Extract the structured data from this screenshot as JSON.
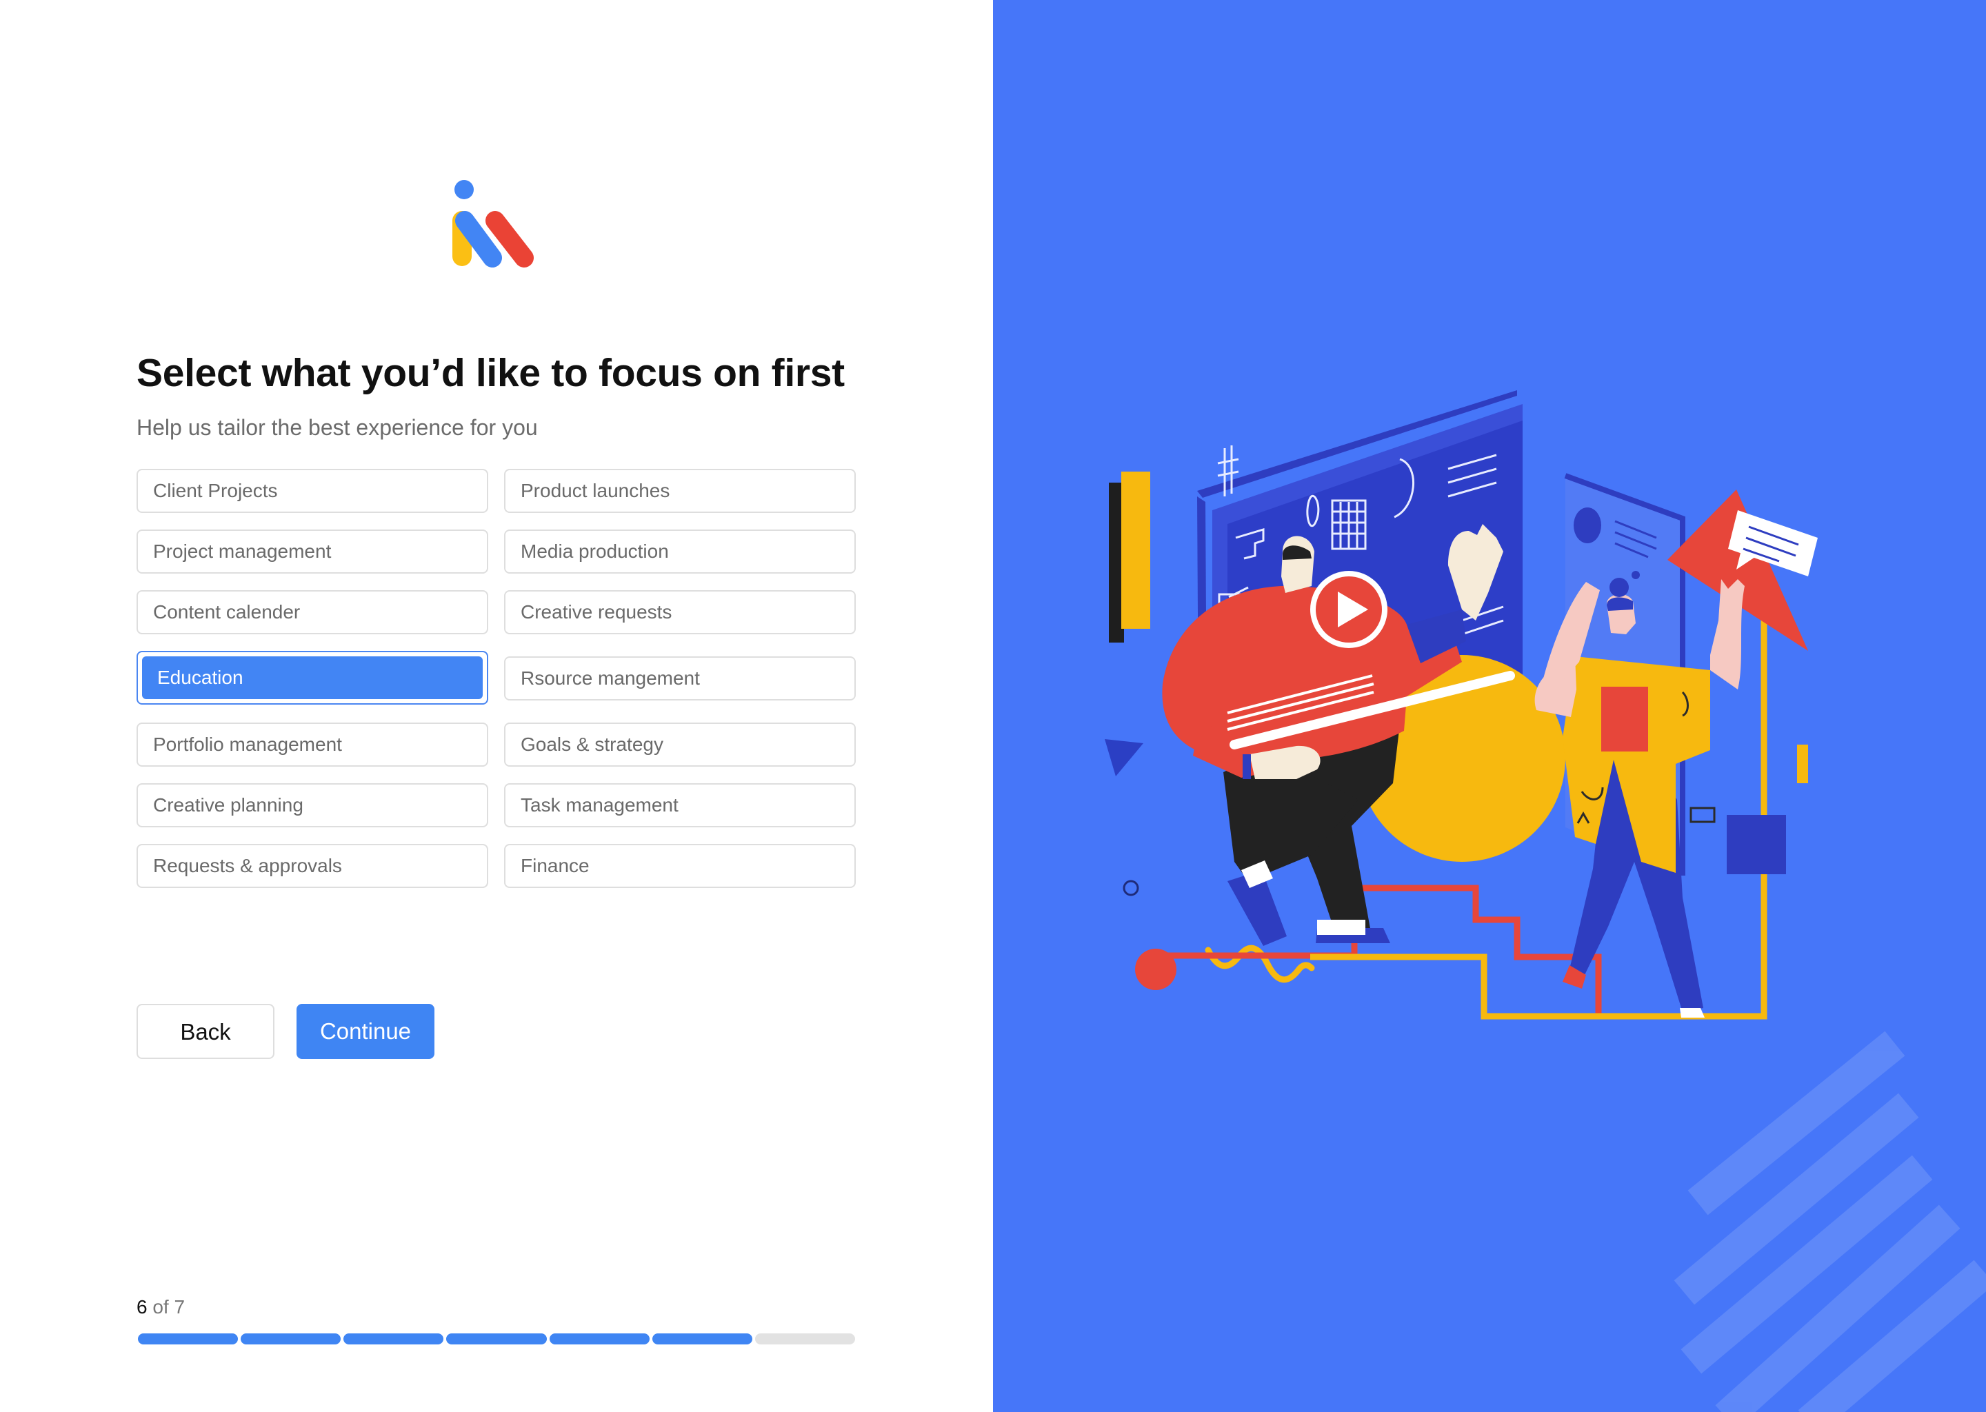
{
  "heading": {
    "title": "Select what you’d like to focus on first",
    "subtitle": "Help us tailor the best experience for you"
  },
  "options": [
    {
      "label": "Client Projects",
      "selected": false
    },
    {
      "label": "Product launches",
      "selected": false
    },
    {
      "label": "Project management",
      "selected": false
    },
    {
      "label": "Media production",
      "selected": false
    },
    {
      "label": "Content calender",
      "selected": false
    },
    {
      "label": "Creative requests",
      "selected": false
    },
    {
      "label": "Education",
      "selected": true
    },
    {
      "label": "Rsource mangement",
      "selected": false
    },
    {
      "label": "Portfolio management",
      "selected": false
    },
    {
      "label": "Goals & strategy",
      "selected": false
    },
    {
      "label": "Creative planning",
      "selected": false
    },
    {
      "label": "Task management",
      "selected": false
    },
    {
      "label": "Requests & approvals",
      "selected": false
    },
    {
      "label": "Finance",
      "selected": false
    }
  ],
  "buttons": {
    "back_label": "Back",
    "continue_label": "Continue"
  },
  "progress": {
    "current": "6",
    "of_text": " of 7",
    "completed_steps": 6,
    "total_steps": 7
  },
  "colors": {
    "accent": "#4285f4",
    "panel": "#4676f9",
    "progress_done": "#3f85f3",
    "progress_todo": "#e2e2e2"
  }
}
